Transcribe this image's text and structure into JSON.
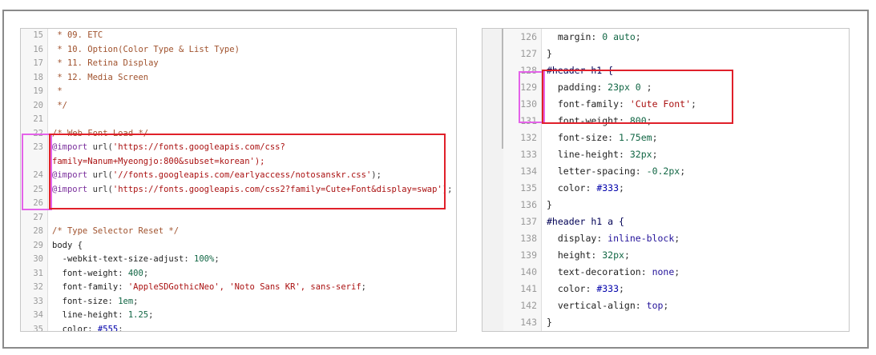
{
  "left_panel": {
    "lines": [
      {
        "num": "15",
        "text": " * 09. ETC",
        "cls": "c-comment"
      },
      {
        "num": "16",
        "text": " * 10. Option(Color Type & List Type)",
        "cls": "c-comment"
      },
      {
        "num": "17",
        "text": " * 11. Retina Display",
        "cls": "c-comment"
      },
      {
        "num": "18",
        "text": " * 12. Media Screen",
        "cls": "c-comment"
      },
      {
        "num": "19",
        "text": " *",
        "cls": "c-comment"
      },
      {
        "num": "20",
        "text": " */",
        "cls": "c-comment"
      },
      {
        "num": "21",
        "text": "",
        "cls": ""
      },
      {
        "num": "22",
        "text": "/* Web Font Load */",
        "cls": "c-comment"
      },
      {
        "num": "23",
        "at": "@import",
        "rest": " url(",
        "str": "'https://fonts.googleapis.com/css?",
        "tail": ""
      },
      {
        "num": "",
        "text": "family=Nanum+Myeongjo:800&subset=korean');",
        "cls": "c-str"
      },
      {
        "num": "24",
        "at": "@import",
        "rest": " url(",
        "str": "'//fonts.googleapis.com/earlyaccess/notosanskr.css'",
        "tail": ");"
      },
      {
        "num": "25",
        "at": "@import",
        "rest": " url(",
        "str": "'https://fonts.googleapis.com/css2?family=Cute+Font&display=swap'",
        "tail": ");"
      },
      {
        "num": "26",
        "text": "",
        "cls": ""
      },
      {
        "num": "27",
        "text": "",
        "cls": ""
      },
      {
        "num": "28",
        "text": "/* Type Selector Reset */",
        "cls": "c-comment"
      },
      {
        "num": "29",
        "text": "body {",
        "cls": "c-sel"
      },
      {
        "num": "30",
        "prop": "  -webkit-text-size-adjust",
        "val": "100%",
        "valcls": "c-num"
      },
      {
        "num": "31",
        "prop": "  font-weight",
        "val": "400",
        "valcls": "c-num"
      },
      {
        "num": "32",
        "prop": "  font-family",
        "val": "'AppleSDGothicNeo', 'Noto Sans KR', sans-serif",
        "valcls": "c-str"
      },
      {
        "num": "33",
        "prop": "  font-size",
        "val": "1em",
        "valcls": "c-num"
      },
      {
        "num": "34",
        "prop": "  line-height",
        "val": "1.25",
        "valcls": "c-num"
      },
      {
        "num": "35",
        "prop": "  color",
        "val": "#555",
        "valcls": "c-col"
      }
    ]
  },
  "right_panel": {
    "lines": [
      {
        "num": "126",
        "prop": "  margin",
        "val": "0 auto",
        "valcls": "c-num"
      },
      {
        "num": "127",
        "text": "}",
        "cls": "c-sel"
      },
      {
        "num": "128",
        "text": "#header h1 {",
        "cls": "c-sel-id"
      },
      {
        "num": "129",
        "prop": "  padding",
        "val": "23px 0 ",
        "valcls": "c-num"
      },
      {
        "num": "130",
        "prop": "  font-family",
        "val": "'Cute Font'",
        "valcls": "c-str"
      },
      {
        "num": "131",
        "prop": "  font-weight",
        "val": "800",
        "valcls": "c-num"
      },
      {
        "num": "132",
        "prop": "  font-size",
        "val": "1.75em",
        "valcls": "c-num"
      },
      {
        "num": "133",
        "prop": "  line-height",
        "val": "32px",
        "valcls": "c-num"
      },
      {
        "num": "134",
        "prop": "  letter-spacing",
        "val": "-0.2px",
        "valcls": "c-num"
      },
      {
        "num": "135",
        "prop": "  color",
        "val": "#333",
        "valcls": "c-col"
      },
      {
        "num": "136",
        "text": "}",
        "cls": "c-sel"
      },
      {
        "num": "137",
        "text": "#header h1 a {",
        "cls": "c-sel-id"
      },
      {
        "num": "138",
        "prop": "  display",
        "val": "inline-block",
        "valcls": "c-kw"
      },
      {
        "num": "139",
        "prop": "  height",
        "val": "32px",
        "valcls": "c-num"
      },
      {
        "num": "140",
        "prop": "  text-decoration",
        "val": "none",
        "valcls": "c-kw"
      },
      {
        "num": "141",
        "prop": "  color",
        "val": "#333",
        "valcls": "c-col"
      },
      {
        "num": "142",
        "prop": "  vertical-align",
        "val": "top",
        "valcls": "c-kw"
      },
      {
        "num": "143",
        "text": "}",
        "cls": "c-sel"
      }
    ]
  },
  "colors": {
    "highlight_red": "#e0202a",
    "highlight_pink": "#e463e9"
  }
}
